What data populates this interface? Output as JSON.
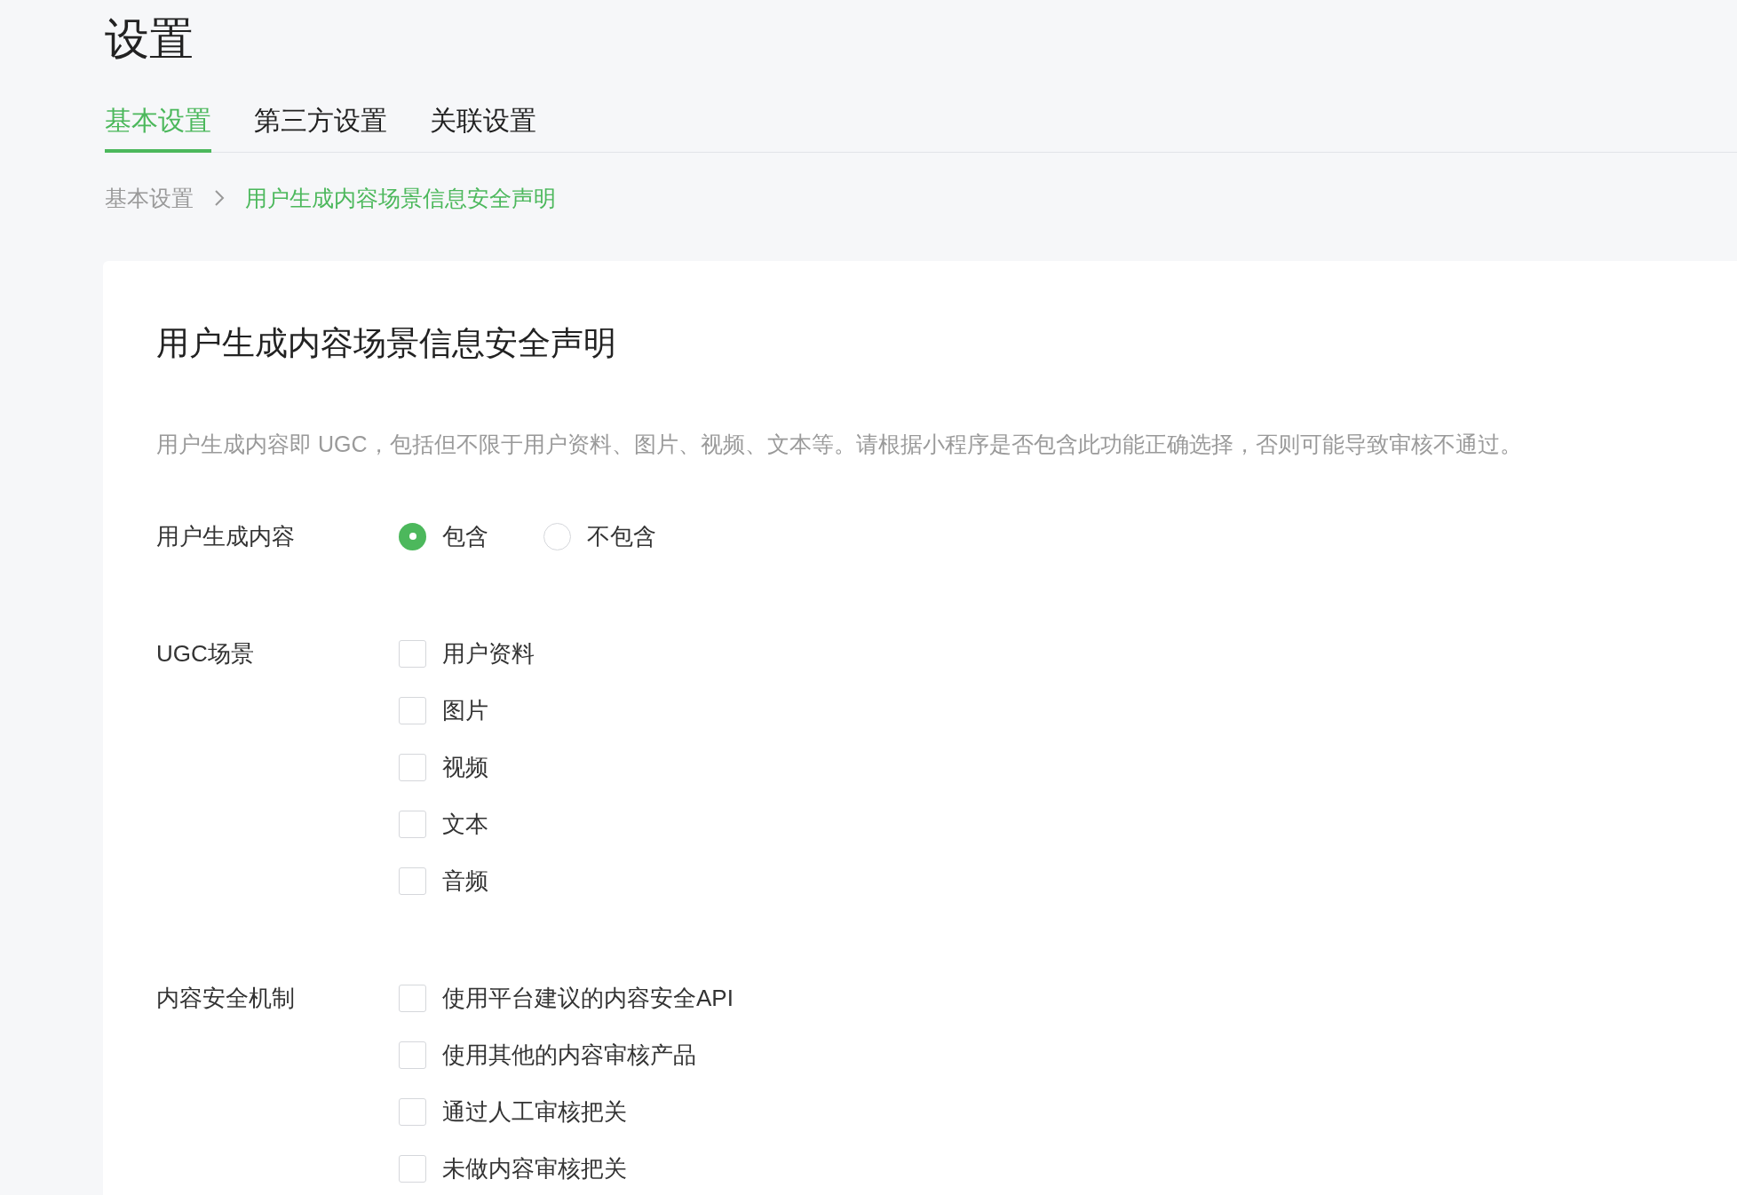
{
  "page_title": "设置",
  "tabs": [
    {
      "label": "基本设置",
      "selected": true
    },
    {
      "label": "第三方设置",
      "selected": false
    },
    {
      "label": "关联设置",
      "selected": false
    }
  ],
  "breadcrumb": [
    {
      "label": "基本设置",
      "current": false
    },
    {
      "label": "用户生成内容场景信息安全声明",
      "current": true
    }
  ],
  "card": {
    "title": "用户生成内容场景信息安全声明",
    "description": "用户生成内容即 UGC，包括但不限于用户资料、图片、视频、文本等。请根据小程序是否包含此功能正确选择，否则可能导致审核不通过。",
    "fields": [
      {
        "label": "用户生成内容",
        "kind": "radio",
        "options": [
          {
            "label": "包含",
            "selected": true
          },
          {
            "label": "不包含",
            "selected": false
          }
        ]
      },
      {
        "label": "UGC场景",
        "kind": "checkbox",
        "options": [
          {
            "label": "用户资料",
            "checked": false
          },
          {
            "label": "图片",
            "checked": false
          },
          {
            "label": "视频",
            "checked": false
          },
          {
            "label": "文本",
            "checked": false
          },
          {
            "label": "音频",
            "checked": false
          }
        ]
      },
      {
        "label": "内容安全机制",
        "kind": "checkbox",
        "options": [
          {
            "label": "使用平台建议的内容安全API",
            "checked": false
          },
          {
            "label": "使用其他的内容审核产品",
            "checked": false
          },
          {
            "label": "通过人工审核把关",
            "checked": false
          },
          {
            "label": "未做内容审核把关",
            "checked": false
          }
        ]
      }
    ]
  }
}
